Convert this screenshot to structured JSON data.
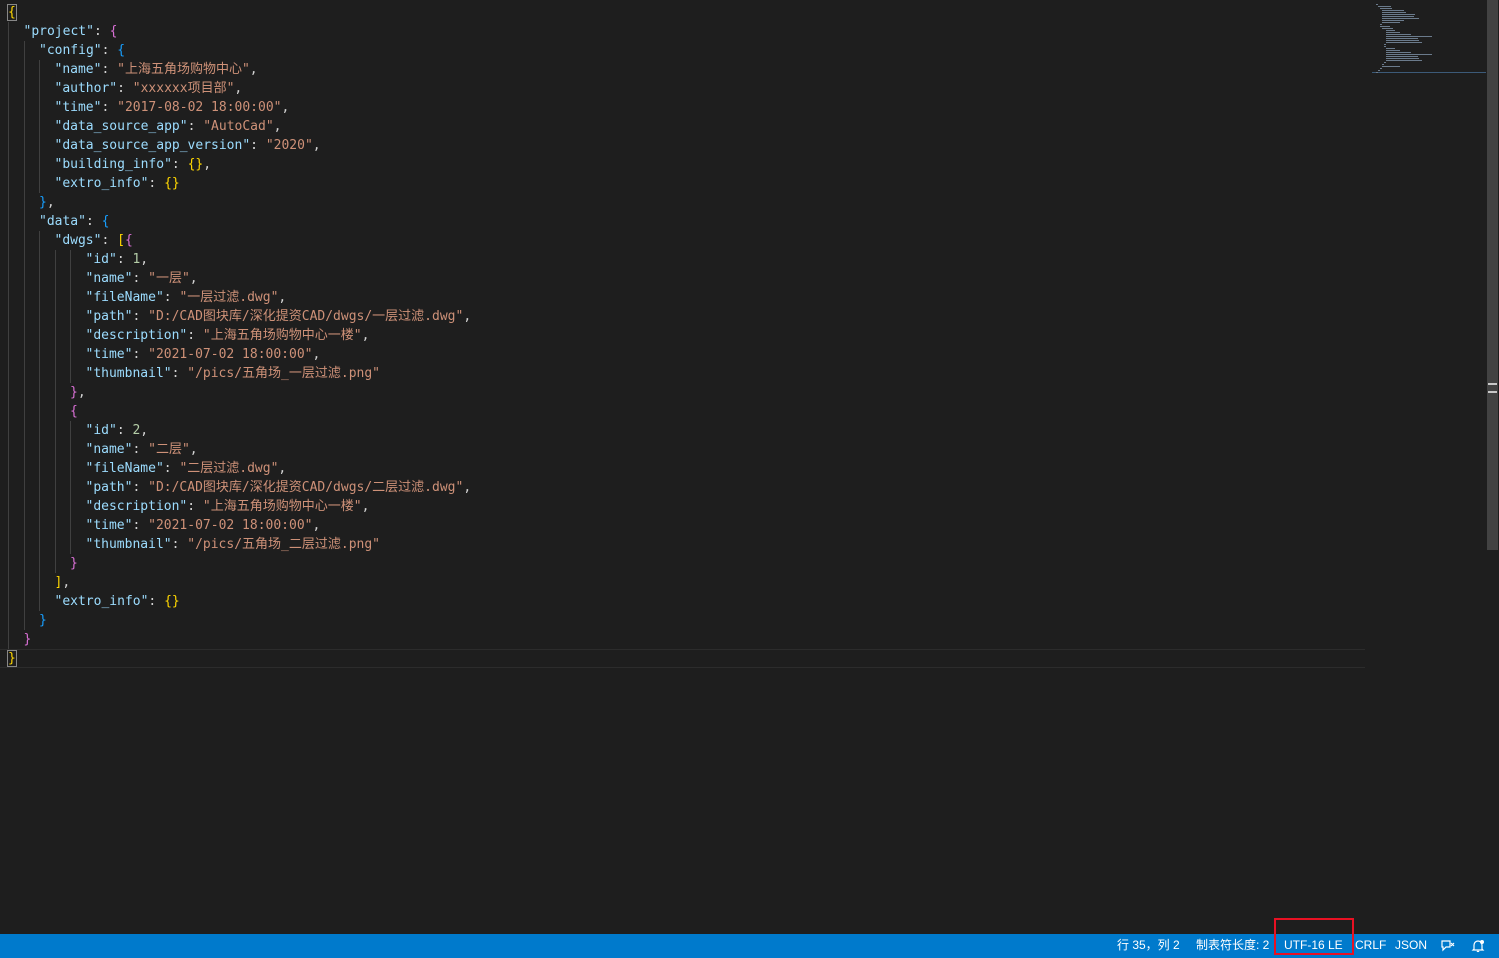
{
  "editor": {
    "lines": [
      [
        [
          "b1",
          "{"
        ]
      ],
      [
        [
          "k",
          "\"project\""
        ],
        [
          "p",
          ": "
        ],
        [
          "b2",
          "{"
        ]
      ],
      [
        [
          "k",
          "\"config\""
        ],
        [
          "p",
          ": "
        ],
        [
          "b3",
          "{"
        ]
      ],
      [
        [
          "k",
          "\"name\""
        ],
        [
          "p",
          ": "
        ],
        [
          "s",
          "\"上海五角场购物中心\""
        ],
        [
          "p",
          ","
        ]
      ],
      [
        [
          "k",
          "\"author\""
        ],
        [
          "p",
          ": "
        ],
        [
          "s",
          "\"xxxxxx项目部\""
        ],
        [
          "p",
          ","
        ]
      ],
      [
        [
          "k",
          "\"time\""
        ],
        [
          "p",
          ": "
        ],
        [
          "s",
          "\"2017-08-02 18:00:00\""
        ],
        [
          "p",
          ","
        ]
      ],
      [
        [
          "k",
          "\"data_source_app\""
        ],
        [
          "p",
          ": "
        ],
        [
          "s",
          "\"AutoCad\""
        ],
        [
          "p",
          ","
        ]
      ],
      [
        [
          "k",
          "\"data_source_app_version\""
        ],
        [
          "p",
          ": "
        ],
        [
          "s",
          "\"2020\""
        ],
        [
          "p",
          ","
        ]
      ],
      [
        [
          "k",
          "\"building_info\""
        ],
        [
          "p",
          ": "
        ],
        [
          "b1",
          "{}"
        ],
        [
          "p",
          ","
        ]
      ],
      [
        [
          "k",
          "\"extro_info\""
        ],
        [
          "p",
          ": "
        ],
        [
          "b1",
          "{}"
        ]
      ],
      [
        [
          "b3",
          "}"
        ],
        [
          "p",
          ","
        ]
      ],
      [
        [
          "k",
          "\"data\""
        ],
        [
          "p",
          ": "
        ],
        [
          "b3",
          "{"
        ]
      ],
      [
        [
          "k",
          "\"dwgs\""
        ],
        [
          "p",
          ": "
        ],
        [
          "b1",
          "["
        ],
        [
          "b2",
          "{"
        ]
      ],
      [
        [
          "k",
          "\"id\""
        ],
        [
          "p",
          ": "
        ],
        [
          "n",
          "1"
        ],
        [
          "p",
          ","
        ]
      ],
      [
        [
          "k",
          "\"name\""
        ],
        [
          "p",
          ": "
        ],
        [
          "s",
          "\"一层\""
        ],
        [
          "p",
          ","
        ]
      ],
      [
        [
          "k",
          "\"fileName\""
        ],
        [
          "p",
          ": "
        ],
        [
          "s",
          "\"一层过滤.dwg\""
        ],
        [
          "p",
          ","
        ]
      ],
      [
        [
          "k",
          "\"path\""
        ],
        [
          "p",
          ": "
        ],
        [
          "s",
          "\"D:/CAD图块库/深化提资CAD/dwgs/一层过滤.dwg\""
        ],
        [
          "p",
          ","
        ]
      ],
      [
        [
          "k",
          "\"description\""
        ],
        [
          "p",
          ": "
        ],
        [
          "s",
          "\"上海五角场购物中心一楼\""
        ],
        [
          "p",
          ","
        ]
      ],
      [
        [
          "k",
          "\"time\""
        ],
        [
          "p",
          ": "
        ],
        [
          "s",
          "\"2021-07-02 18:00:00\""
        ],
        [
          "p",
          ","
        ]
      ],
      [
        [
          "k",
          "\"thumbnail\""
        ],
        [
          "p",
          ": "
        ],
        [
          "s",
          "\"/pics/五角场_一层过滤.png\""
        ]
      ],
      [
        [
          "b2",
          "}"
        ],
        [
          "p",
          ","
        ]
      ],
      [
        [
          "b2",
          "{"
        ]
      ],
      [
        [
          "k",
          "\"id\""
        ],
        [
          "p",
          ": "
        ],
        [
          "n",
          "2"
        ],
        [
          "p",
          ","
        ]
      ],
      [
        [
          "k",
          "\"name\""
        ],
        [
          "p",
          ": "
        ],
        [
          "s",
          "\"二层\""
        ],
        [
          "p",
          ","
        ]
      ],
      [
        [
          "k",
          "\"fileName\""
        ],
        [
          "p",
          ": "
        ],
        [
          "s",
          "\"二层过滤.dwg\""
        ],
        [
          "p",
          ","
        ]
      ],
      [
        [
          "k",
          "\"path\""
        ],
        [
          "p",
          ": "
        ],
        [
          "s",
          "\"D:/CAD图块库/深化提资CAD/dwgs/二层过滤.dwg\""
        ],
        [
          "p",
          ","
        ]
      ],
      [
        [
          "k",
          "\"description\""
        ],
        [
          "p",
          ": "
        ],
        [
          "s",
          "\"上海五角场购物中心一楼\""
        ],
        [
          "p",
          ","
        ]
      ],
      [
        [
          "k",
          "\"time\""
        ],
        [
          "p",
          ": "
        ],
        [
          "s",
          "\"2021-07-02 18:00:00\""
        ],
        [
          "p",
          ","
        ]
      ],
      [
        [
          "k",
          "\"thumbnail\""
        ],
        [
          "p",
          ": "
        ],
        [
          "s",
          "\"/pics/五角场_二层过滤.png\""
        ]
      ],
      [
        [
          "b2",
          "}"
        ]
      ],
      [
        [
          "b1",
          "]"
        ],
        [
          "p",
          ","
        ]
      ],
      [
        [
          "k",
          "\"extro_info\""
        ],
        [
          "p",
          ": "
        ],
        [
          "b1",
          "{}"
        ]
      ],
      [
        [
          "b3",
          "}"
        ]
      ],
      [
        [
          "b2",
          "}"
        ]
      ],
      [
        [
          "b1",
          "}"
        ]
      ]
    ],
    "indents": [
      0,
      1,
      2,
      3,
      3,
      3,
      3,
      3,
      3,
      3,
      2,
      2,
      3,
      5,
      5,
      5,
      5,
      5,
      5,
      5,
      4,
      4,
      5,
      5,
      5,
      5,
      5,
      5,
      5,
      4,
      3,
      3,
      2,
      1,
      0
    ],
    "current_line": 35
  },
  "statusbar": {
    "position": "行 35，列 2",
    "indent": "制表符长度: 2",
    "encoding": "UTF-16 LE",
    "eol": "CRLF",
    "language": "JSON",
    "feedback_icon": "feedback-icon",
    "notifications_icon": "bell-icon"
  },
  "colors": {
    "statusbar_bg": "#007acc",
    "highlight": "#e81123"
  }
}
